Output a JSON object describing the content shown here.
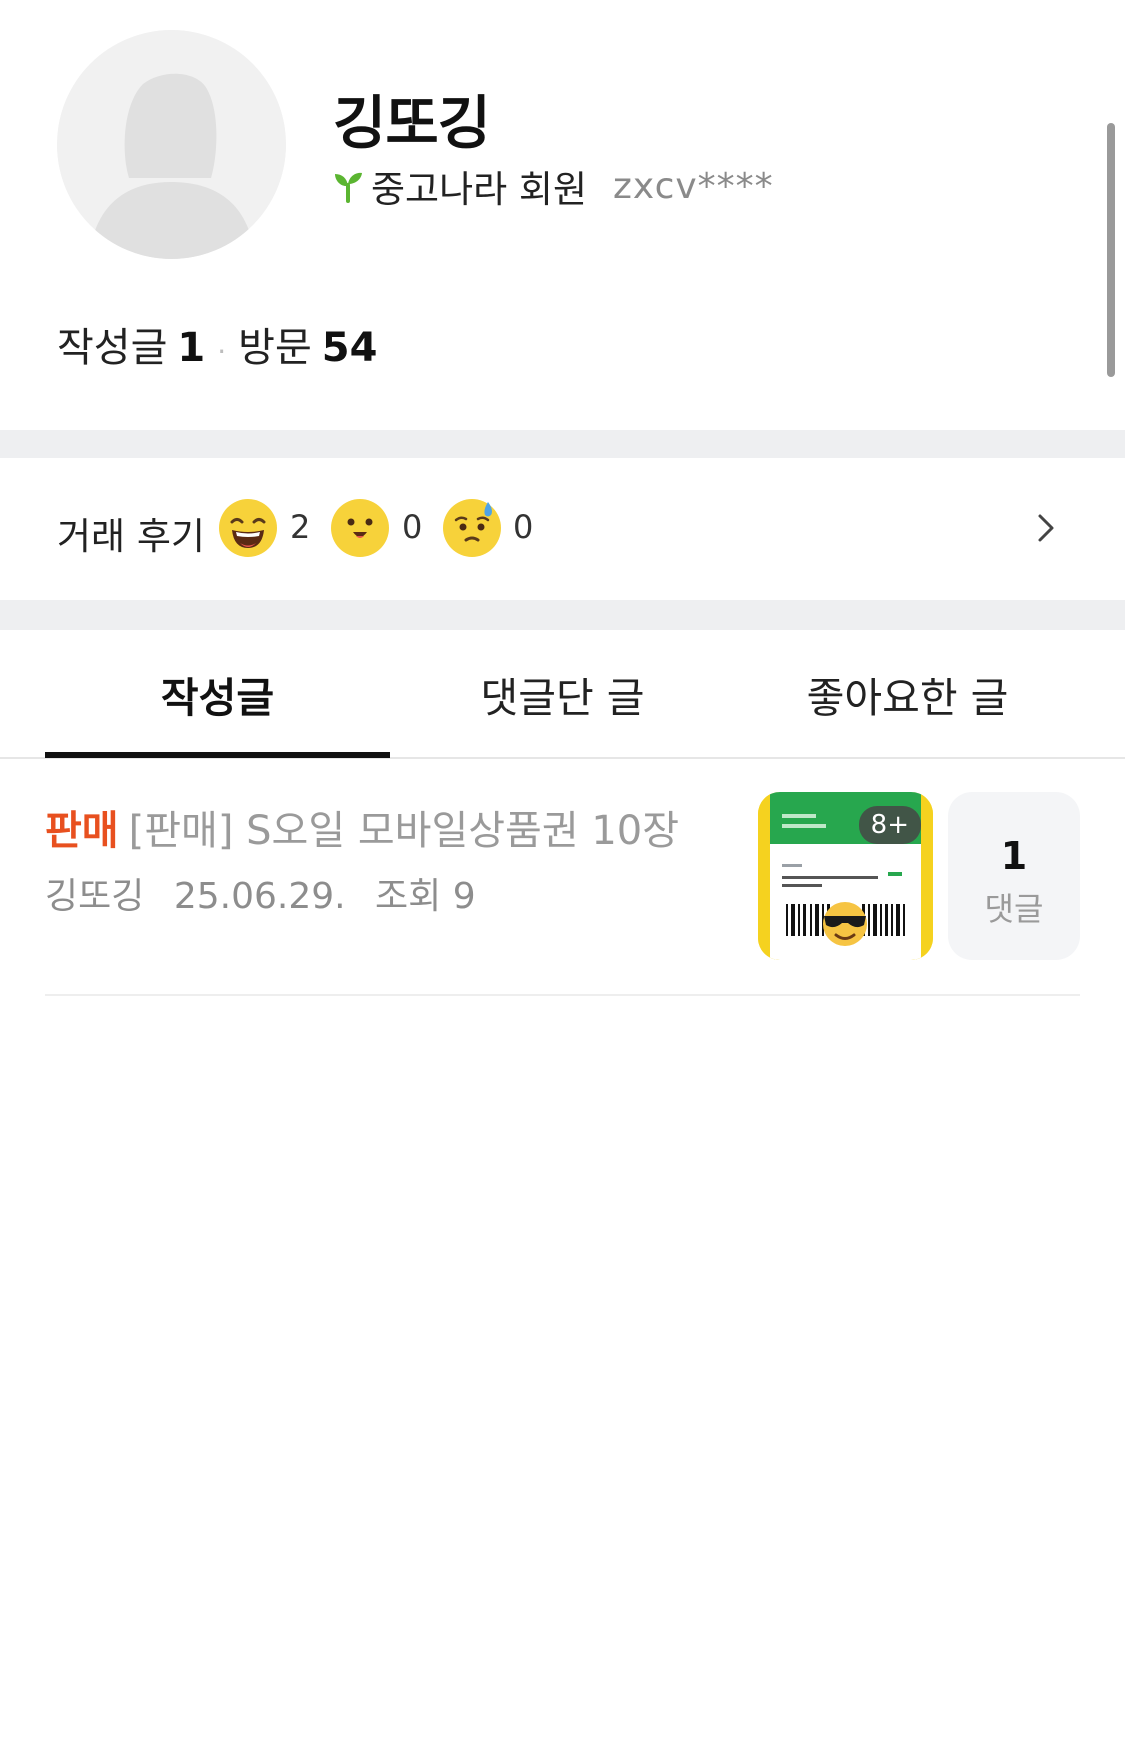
{
  "profile": {
    "nickname": "깅또깅",
    "grade": "중고나라 회원",
    "user_id": "zxcv****",
    "posts_label": "작성글",
    "posts_count": "1",
    "visits_label": "방문",
    "visits_count": "54"
  },
  "reviews": {
    "label": "거래 후기",
    "items": [
      {
        "icon": "laughing-face-icon",
        "count": "2"
      },
      {
        "icon": "smiling-face-icon",
        "count": "0"
      },
      {
        "icon": "sweating-face-icon",
        "count": "0"
      }
    ]
  },
  "tabs": [
    {
      "label": "작성글",
      "active": true
    },
    {
      "label": "댓글단 글",
      "active": false
    },
    {
      "label": "좋아요한 글",
      "active": false
    }
  ],
  "posts": [
    {
      "badge": "판매",
      "title": "[판매] S오일 모바일상품권 10장",
      "author": "깅또깅",
      "date": "25.06.29.",
      "views": "조회 9",
      "image_count": "8+",
      "comment_count": "1",
      "comment_label": "댓글"
    }
  ],
  "colors": {
    "accent_sale": "#e8501f",
    "sprout_green": "#5bb531",
    "divider_band": "#eeeff1"
  }
}
